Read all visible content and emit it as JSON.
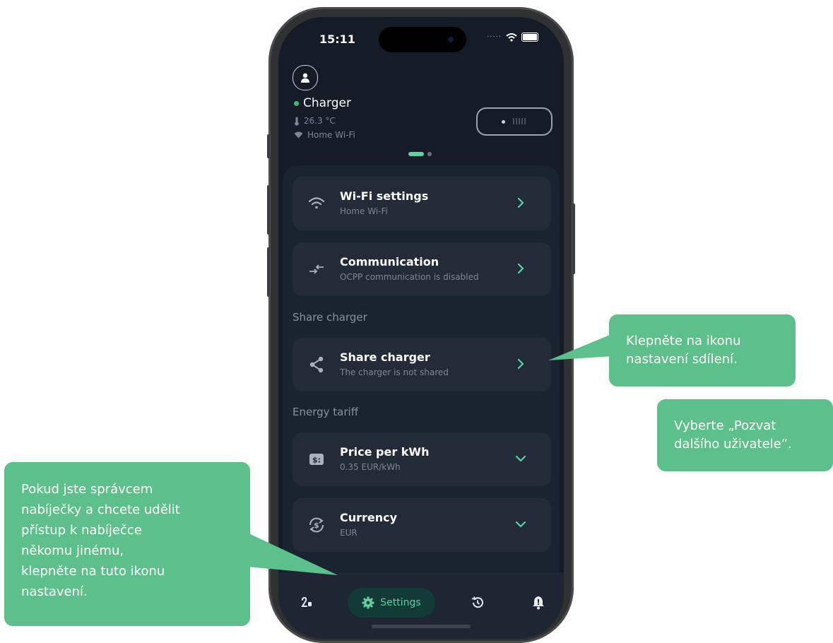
{
  "status_bar": {
    "time": "15:11"
  },
  "device": {
    "name": "Charger",
    "temperature": "26.3 °C",
    "network": "Home Wi-Fi"
  },
  "settings": {
    "wifi": {
      "title": "Wi-Fi settings",
      "subtitle": "Home Wi-Fi"
    },
    "communication": {
      "title": "Communication",
      "subtitle": "OCPP communication is disabled"
    },
    "share_section": "Share charger",
    "share": {
      "title": "Share charger",
      "subtitle": "The charger is not shared"
    },
    "tariff_section": "Energy tariff",
    "price": {
      "title": "Price per kWh",
      "subtitle": "0.35 EUR/kWh"
    },
    "currency": {
      "title": "Currency",
      "subtitle": "EUR"
    }
  },
  "bottom_nav": {
    "settings_label": "Settings"
  },
  "callouts": {
    "share_icon": [
      "Klepněte na ikonu",
      "nastavení sdílení."
    ],
    "invite": [
      "Vyberte „Pozvat",
      "dalšího uživatele“."
    ],
    "admin": [
      "Pokud jste správcem",
      "nabíječky a chcete udělit",
      "přístup k nabíječce",
      "někomu jinému,",
      "klepněte na tuto ikonu",
      "nastavení."
    ]
  },
  "colors": {
    "accent": "#5fd0a3",
    "callout": "#5cbf8c",
    "background": "#151c27"
  }
}
